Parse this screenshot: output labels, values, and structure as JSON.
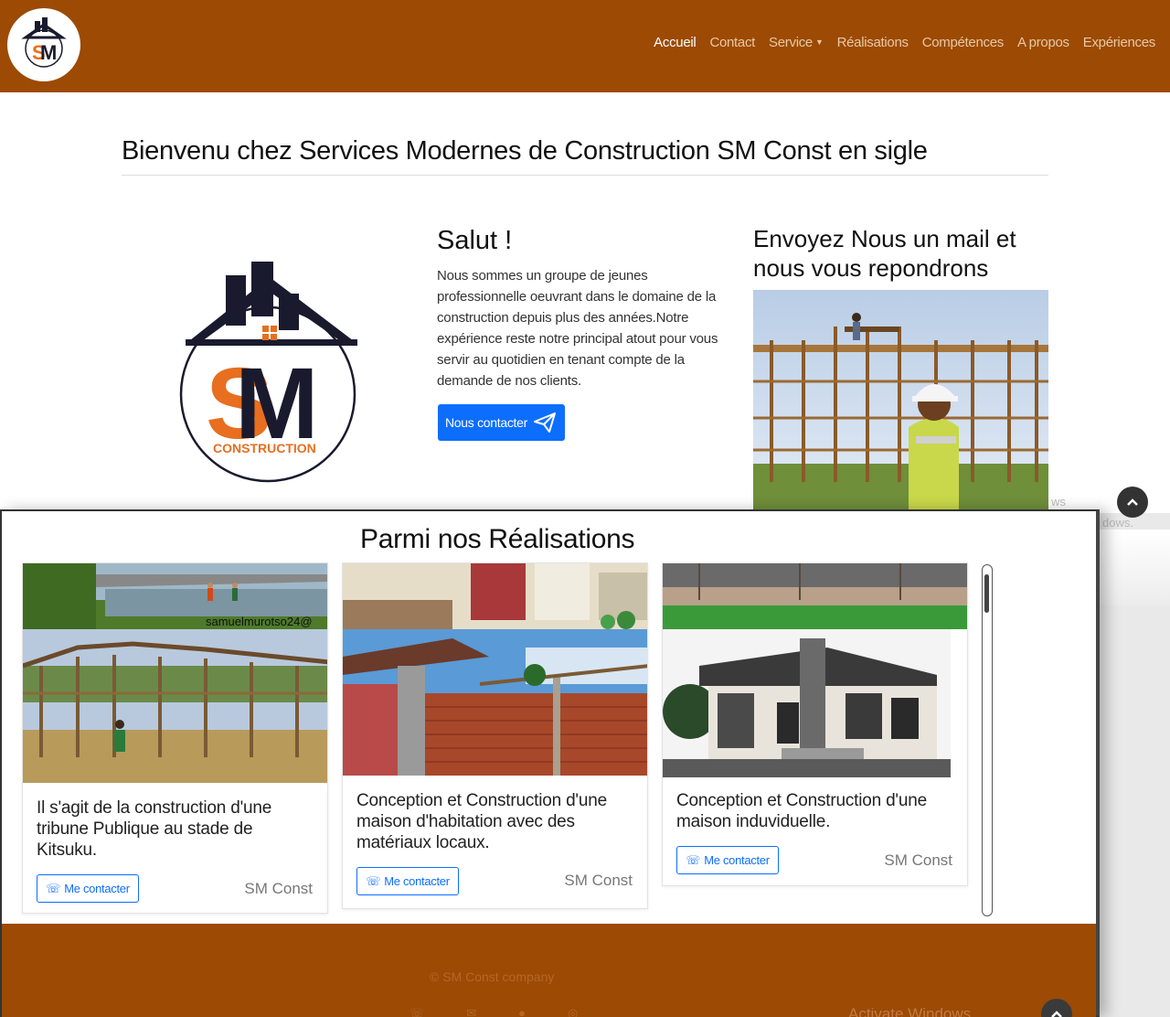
{
  "navbar": {
    "links": [
      "Accueil",
      "Contact",
      "Service",
      "Réalisations",
      "Compétences",
      "A propos",
      "Expériences"
    ],
    "active_color": "#ffffff",
    "bg_color": "#9c4a04"
  },
  "hero": {
    "welcome": "Bienvenu chez Services Modernes de Construction SM Const en sigle",
    "salut": "Salut !",
    "intro": "Nous sommes un groupe de jeunes professionnelle oeuvrant dans le domaine de la construction depuis plus des années.Notre expérience reste notre principal atout pour vous servir au quotidien en tenant compte de la demande de nos clients.",
    "contact_button": "Nous contacter",
    "mail_title": "Envoyez Nous un mail et nous vous repondrons",
    "logo_text": "CONSTRUCTION"
  },
  "realisations": {
    "title": "Parmi nos Réalisations",
    "cards": [
      {
        "text": "Il s'agit de la construction d'une tribune Publique au stade de Kitsuku.",
        "button": "Me contacter",
        "brand": "SM Const",
        "photo_caption": "samuelmurotso24@"
      },
      {
        "text": "Conception et Construction d'une maison d'habitation avec des matériaux locaux.",
        "button": "Me contacter",
        "brand": "SM Const"
      },
      {
        "text": "Conception et Construction d'une maison induviduelle.",
        "button": "Me contacter",
        "brand": "SM Const"
      }
    ]
  },
  "footer": {
    "copyright": "© SM Const company",
    "watermark": "Activate Windows",
    "icons": [
      "phone-icon",
      "mail-icon",
      "facebook-icon",
      "whatsapp-icon"
    ]
  },
  "watermark_top": "ws",
  "watermark_top2": "dows."
}
